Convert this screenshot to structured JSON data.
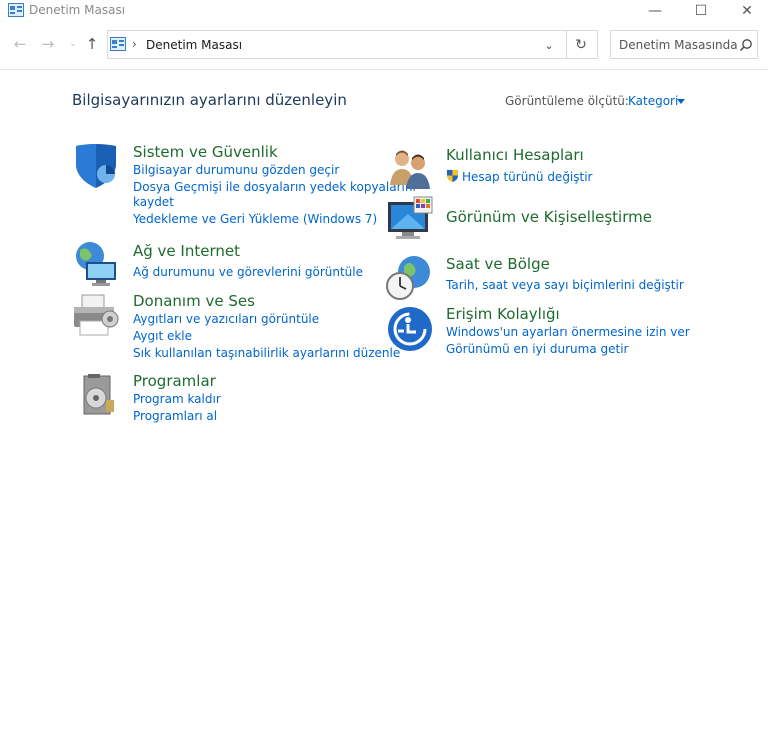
{
  "window": {
    "title": "Denetim Masası",
    "minimize_glyph": "—",
    "maximize_glyph": "☐",
    "close_glyph": "✕"
  },
  "nav": {
    "back_glyph": "←",
    "forward_glyph": "→",
    "recent_glyph": "⌄",
    "up_glyph": "↑",
    "breadcrumb_separator": "›",
    "address_text": "Denetim Masası",
    "dropdown_glyph": "⌄",
    "refresh_glyph": "↻",
    "search_placeholder": "Denetim Masasında..."
  },
  "page": {
    "heading": "Bilgisayarınızın ayarlarını düzenleyin",
    "view_by_label": "Görüntüleme ölçütü:",
    "view_by_value": "Kategori"
  },
  "categories": {
    "system": {
      "title": "Sistem ve Güvenlik",
      "icon": "shield-icon",
      "links": [
        "Bilgisayar durumunu gözden geçir",
        "Dosya Geçmişi ile dosyaların yedek kopyalarını",
        "kaydet",
        "Yedekleme ve Geri Yükleme (Windows 7)"
      ]
    },
    "network": {
      "title": "Ağ ve Internet",
      "icon": "network-globe-icon",
      "links": [
        "Ağ durumunu ve görevlerini görüntüle"
      ]
    },
    "hardware": {
      "title": "Donanım ve Ses",
      "icon": "printer-icon",
      "links": [
        "Aygıtları ve yazıcıları görüntüle",
        "Aygıt ekle",
        "Sık kullanılan taşınabilirlik ayarlarını düzenle"
      ]
    },
    "programs": {
      "title": "Programlar",
      "icon": "programs-disc-icon",
      "links": [
        "Program kaldır",
        "Programları al"
      ]
    },
    "users": {
      "title": "Kullanıcı Hesapları",
      "icon": "users-icon",
      "links": [
        "Hesap türünü değiştir"
      ]
    },
    "appearance": {
      "title": "Görünüm ve Kişiselleştirme",
      "icon": "monitor-palette-icon",
      "links": []
    },
    "clock": {
      "title": "Saat ve Bölge",
      "icon": "clock-globe-icon",
      "links": [
        "Tarih, saat veya sayı biçimlerini değiştir"
      ]
    },
    "access": {
      "title": "Erişim Kolaylığı",
      "icon": "ease-of-access-icon",
      "links": [
        "Windows'un ayarları önermesine izin ver",
        "Görünümü en iyi duruma getir"
      ]
    }
  },
  "colors": {
    "heading": "#1e395b",
    "category_title": "#1e6b2e",
    "link": "#0066cc"
  }
}
